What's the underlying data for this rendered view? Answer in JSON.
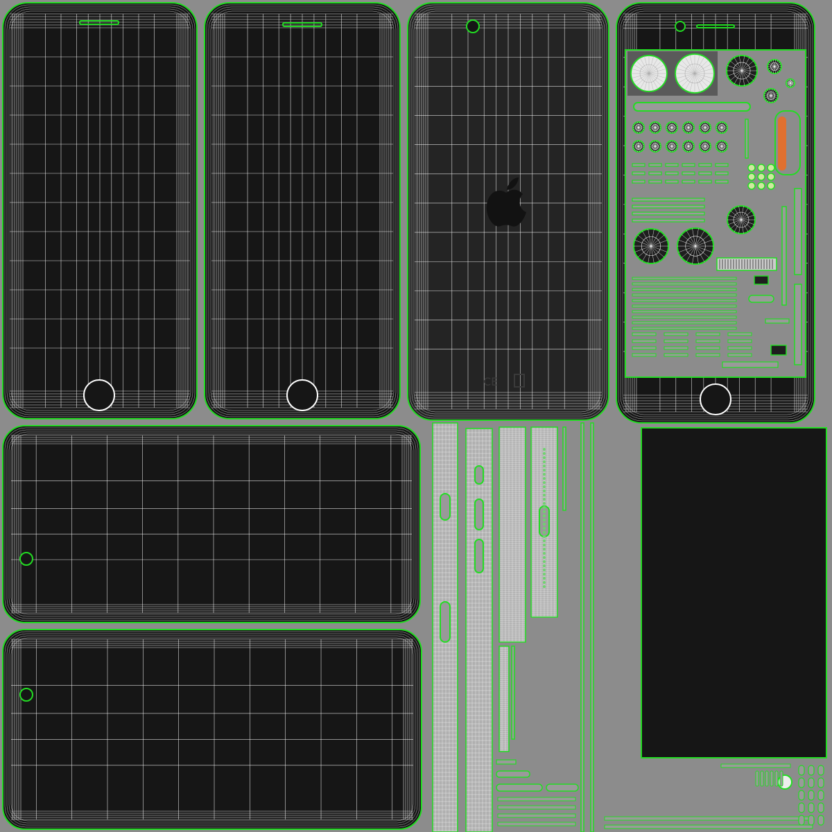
{
  "colors": {
    "background": "#8c8c8c",
    "panel_fill": "#161616",
    "back_fill": "#242424",
    "wire": "#ffffff",
    "edge": "#22dd22",
    "edge_dark": "#0a6a0a",
    "part_fill": "#9a9a9a",
    "accent": "#e07030"
  },
  "icons": {
    "logo": "apple-logo-icon",
    "home_button": "home-button-icon",
    "camera": "camera-icon",
    "regulatory_marks": "ce-mark-icon"
  },
  "back_panel": {
    "regulatory_text": "CE"
  }
}
